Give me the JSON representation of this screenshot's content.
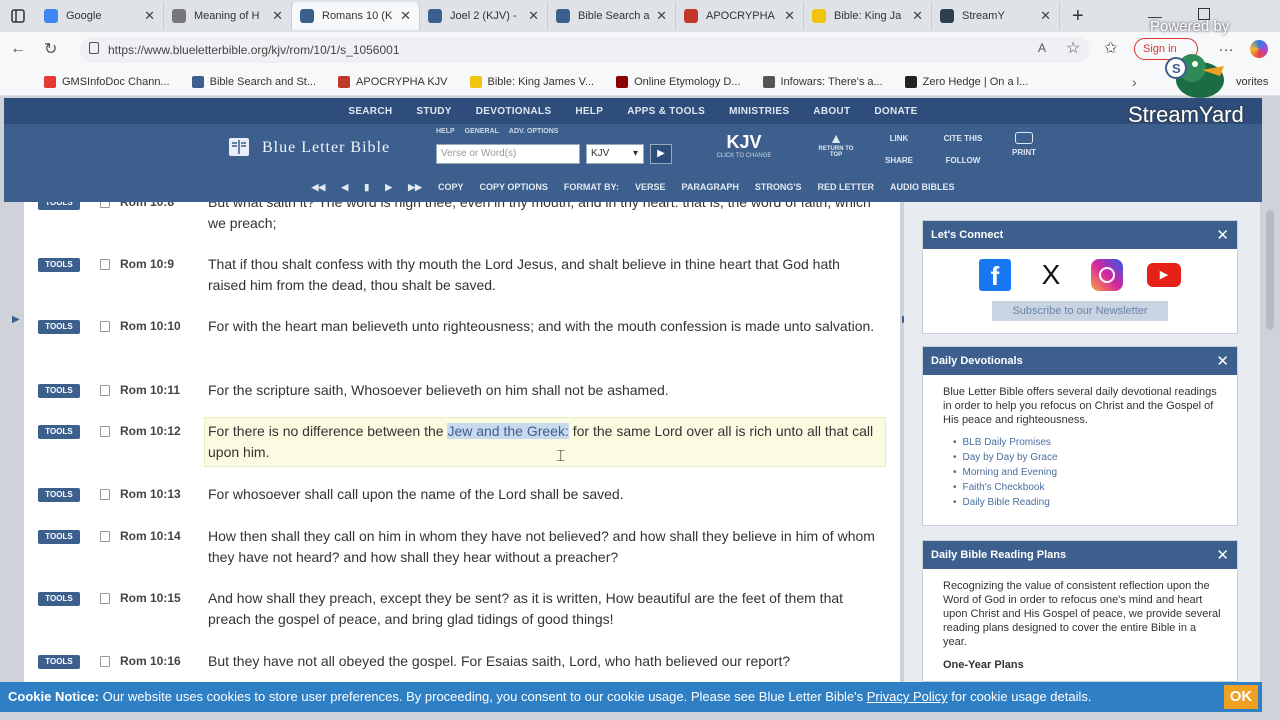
{
  "browser": {
    "tabs": [
      {
        "label": "Google",
        "color": "#4285f4",
        "active": false
      },
      {
        "label": "Meaning of H",
        "color": "#777777",
        "active": false
      },
      {
        "label": "Romans 10 (K",
        "color": "#3d5f8e",
        "active": true
      },
      {
        "label": "Joel 2 (KJV) -",
        "color": "#3d5f8e",
        "active": false
      },
      {
        "label": "Bible Search a",
        "color": "#3d5f8e",
        "active": false
      },
      {
        "label": "APOCRYPHA",
        "color": "#c0392b",
        "active": false
      },
      {
        "label": "Bible: King Ja",
        "color": "#f1c40f",
        "active": false
      },
      {
        "label": "StreamY",
        "color": "#2c3e50",
        "active": false
      }
    ],
    "url": "https://www.blueletterbible.org/kjv/rom/10/1/s_1056001",
    "signin_label": "Sign in",
    "bookmarks": [
      {
        "label": "GMSInfoDoc Chann...",
        "color": "#e53935"
      },
      {
        "label": "Bible Search and St...",
        "color": "#3d5f8e"
      },
      {
        "label": "APOCRYPHA KJV",
        "color": "#c0392b"
      },
      {
        "label": "Bible: King James V...",
        "color": "#f1c40f"
      },
      {
        "label": "Online Etymology D...",
        "color": "#8b0000"
      },
      {
        "label": "Infowars: There's a...",
        "color": "#555555"
      },
      {
        "label": "Zero Hedge | On a l...",
        "color": "#222222"
      }
    ],
    "favorites_label": "vorites"
  },
  "overlay": {
    "powered_by": "Powered by",
    "brand": "StreamYard"
  },
  "site": {
    "nav": [
      "SEARCH",
      "STUDY",
      "DEVOTIONALS",
      "HELP",
      "APPS & TOOLS",
      "MINISTRIES",
      "ABOUT",
      "DONATE"
    ],
    "logo": "Blue Letter Bible",
    "search_links": [
      "HELP",
      "GENERAL",
      "ADV. OPTIONS"
    ],
    "search_placeholder": "Verse or Word(s)",
    "version": "KJV",
    "version_big": "KJV",
    "version_hint": "CLICK TO CHANGE",
    "return_to_top": "RETURN TO TOP",
    "link": "LINK",
    "share": "SHARE",
    "cite": "CITE THIS",
    "follow": "FOLLOW",
    "print": "PRINT",
    "toolbar": [
      "COPY",
      "COPY OPTIONS",
      "FORMAT BY:",
      "VERSE",
      "PARAGRAPH",
      "STRONG'S",
      "RED LETTER",
      "AUDIO BIBLES"
    ]
  },
  "verses": [
    {
      "ref": "Rom 10:8",
      "text": "But what saith it? The word is nigh thee, even in thy mouth, and in thy heart: that is, the word of faith, which we preach;"
    },
    {
      "ref": "Rom 10:9",
      "text": "That if thou shalt confess with thy mouth the Lord Jesus, and shalt believe in thine heart that God hath raised him from the dead, thou shalt be saved."
    },
    {
      "ref": "Rom 10:10",
      "text": "For with the heart man believeth unto righteousness; and with the mouth confession is made unto salvation."
    },
    {
      "ref": "Rom 10:11",
      "text": "For the scripture saith, Whosoever believeth on him shall not be ashamed."
    },
    {
      "ref": "Rom 10:12",
      "text_pre": "For there is no difference between the ",
      "text_sel": "Jew and the Greek:",
      "text_post": " for the same Lord over all is rich unto all that call upon him."
    },
    {
      "ref": "Rom 10:13",
      "text": "For whosoever shall call upon the name of the Lord shall be saved."
    },
    {
      "ref": "Rom 10:14",
      "text": "How then shall they call on him in whom they have not believed? and how shall they believe in him of whom they have not heard? and how shall they hear without a preacher?"
    },
    {
      "ref": "Rom 10:15",
      "text": "And how shall they preach, except they be sent? as it is written, How beautiful are the feet of them that preach the gospel of peace, and bring glad tidings of good things!"
    },
    {
      "ref": "Rom 10:16",
      "text": "But they have not all obeyed the gospel. For Esaias saith, Lord, who hath believed our report?"
    }
  ],
  "tools_label": "TOOLS",
  "sidebar": {
    "connect_title": "Let's Connect",
    "newsletter": "Subscribe to our Newsletter",
    "devotionals_title": "Daily Devotionals",
    "devotionals_text": "Blue Letter Bible offers several daily devotional readings in order to help you refocus on Christ and the Gospel of His peace and righteousness.",
    "devotionals_links": [
      "BLB Daily Promises",
      "Day by Day by Grace",
      "Morning and Evening",
      "Faith's Checkbook",
      "Daily Bible Reading"
    ],
    "plans_title": "Daily Bible Reading Plans",
    "plans_text": "Recognizing the value of consistent reflection upon the Word of God in order to refocus one's mind and heart upon Christ and His Gospel of peace, we provide several reading plans designed to cover the entire Bible in a year.",
    "plans_sub": "One-Year Plans"
  },
  "cookie": {
    "label": "Cookie Notice:",
    "text": " Our website uses cookies to store user preferences. By proceeding, you consent to our cookie usage. Please see Blue Letter Bible's ",
    "link": "Privacy Policy",
    "tail": " for cookie usage details.",
    "ok": "OK"
  }
}
